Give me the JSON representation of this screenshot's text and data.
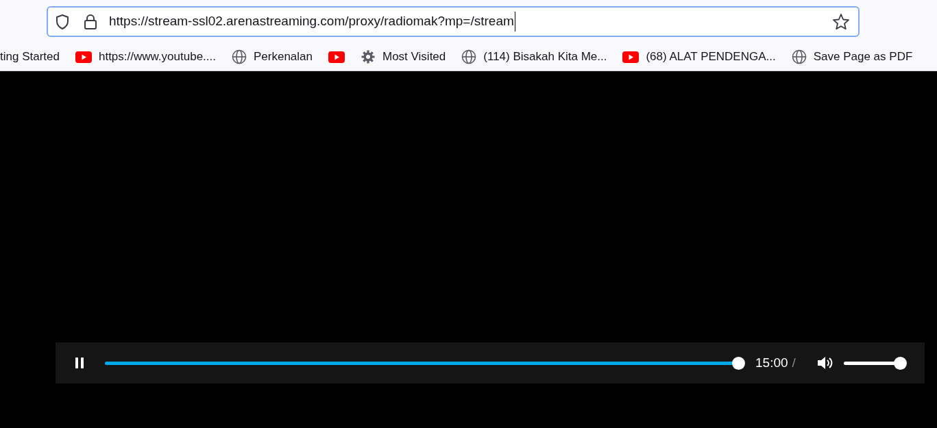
{
  "address_bar": {
    "url": "https://stream-ssl02.arenastreaming.com/proxy/radiomak?mp=/stream"
  },
  "bookmarks": [
    {
      "kind": "plain",
      "label": "ting Started"
    },
    {
      "kind": "youtube",
      "label": "https://www.youtube...."
    },
    {
      "kind": "globe",
      "label": "Perkenalan"
    },
    {
      "kind": "youtube"
    },
    {
      "kind": "gear",
      "label": "Most Visited"
    },
    {
      "kind": "globe",
      "label": "(114) Bisakah Kita Me..."
    },
    {
      "kind": "youtube",
      "label": "(68) ALAT PENDENGA..."
    },
    {
      "kind": "globe",
      "label": "Save Page as PDF"
    }
  ],
  "player": {
    "playing": true,
    "progress": {
      "level": 1
    },
    "time": "15:00",
    "separator": "/",
    "volume": {
      "level": 1
    }
  }
}
